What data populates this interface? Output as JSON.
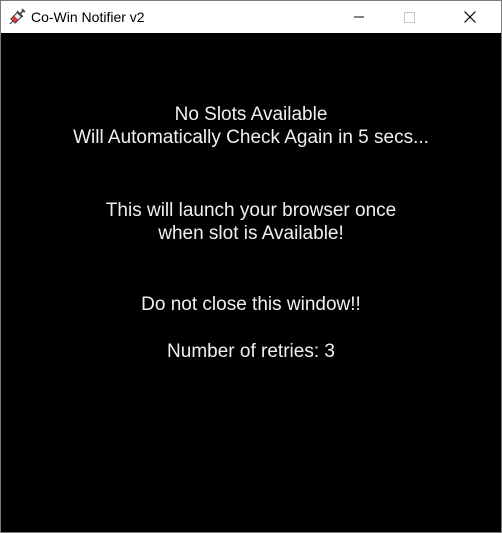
{
  "window": {
    "title": "Co-Win Notifier v2",
    "icon": "syringe-icon",
    "controls": {
      "minimize_icon": "minimize-icon",
      "maximize_icon": "maximize-icon",
      "close_icon": "close-icon"
    },
    "colors": {
      "titlebar_bg": "#ffffff",
      "content_bg": "#000000",
      "text": "#f0f0f0"
    }
  },
  "status": {
    "line1": "No Slots Available",
    "line2": "Will Automatically Check Again in 5 secs..."
  },
  "info": {
    "line1": "This will launch your browser once",
    "line2": "when slot is Available!"
  },
  "warning": "Do not close this window!!",
  "retries": "Number of retries: 3"
}
